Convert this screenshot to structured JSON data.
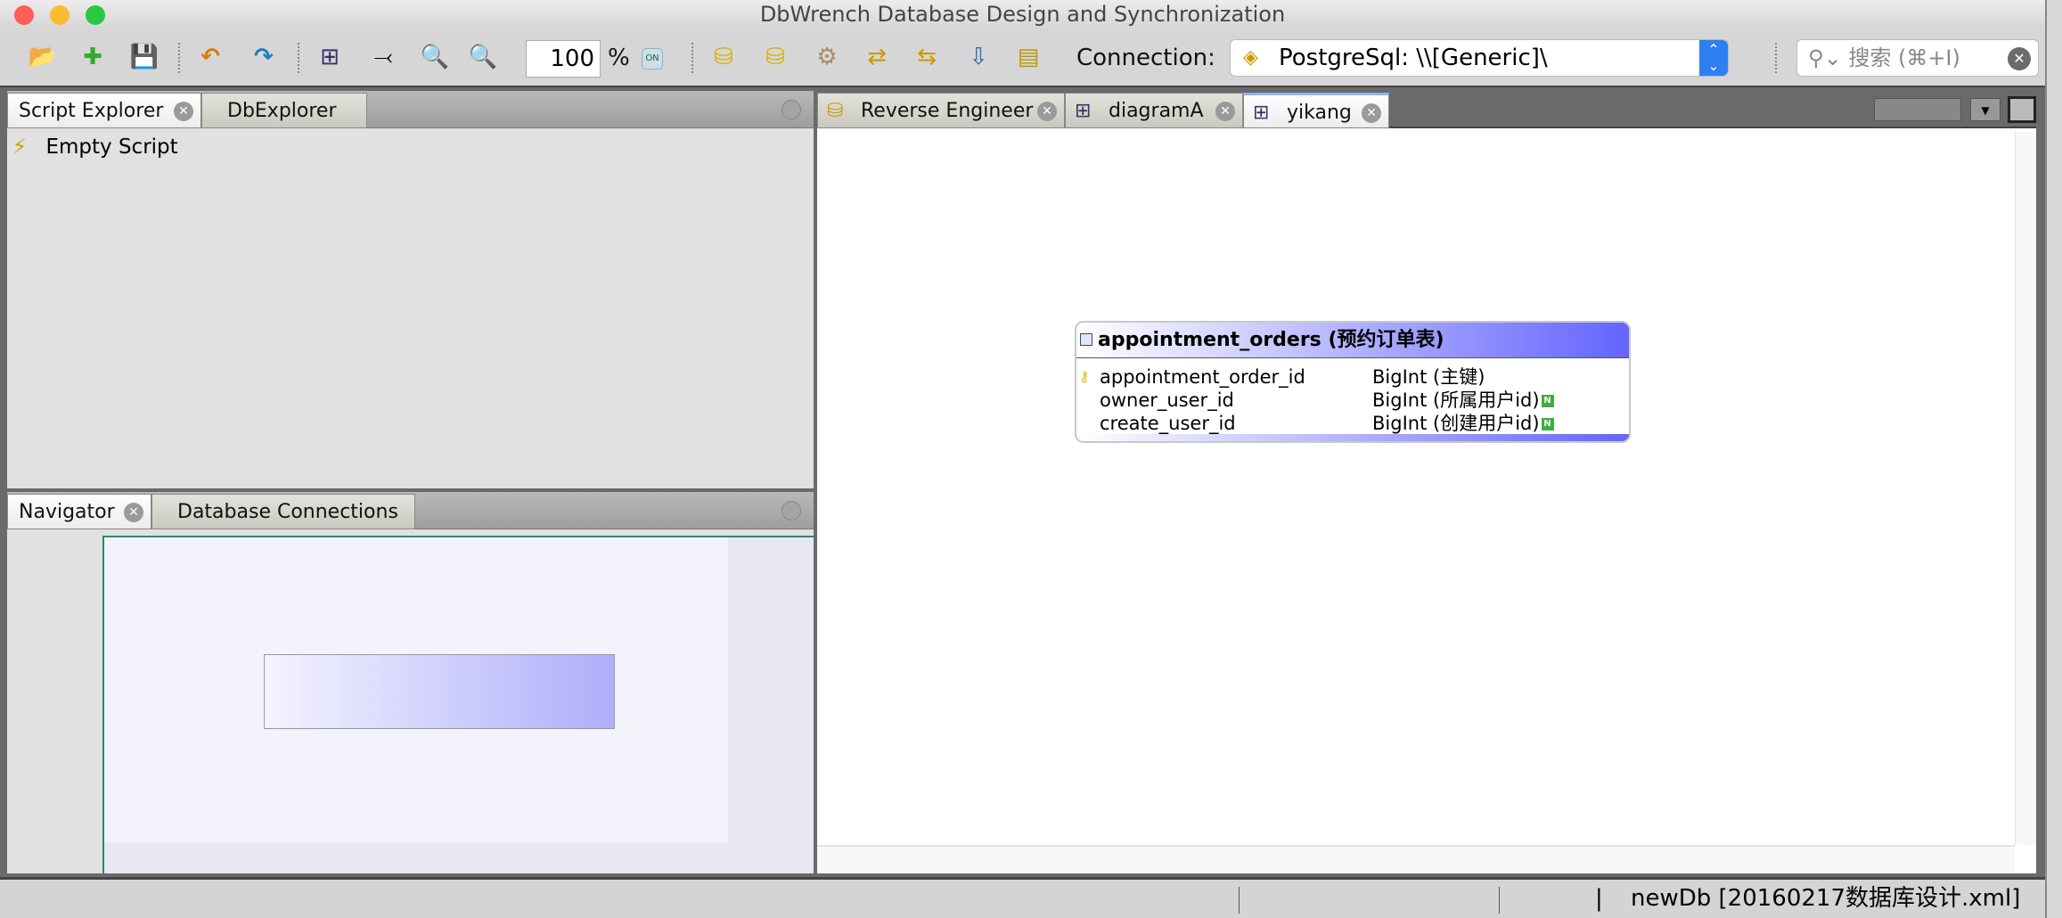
{
  "window": {
    "title": "DbWrench Database Design and Synchronization"
  },
  "toolbar": {
    "icons": [
      "open-icon",
      "new-icon",
      "save-icon",
      "undo-icon",
      "redo-icon",
      "layout-diagram-icon",
      "relationship-icon",
      "zoom-in-icon",
      "zoom-out-icon",
      "zoom-fit-icon",
      "forward-engineer-icon",
      "reverse-engineer-icon",
      "settings-icon",
      "sync-icon",
      "sync-all-icon",
      "export-icon",
      "script-icon"
    ],
    "zoom_value": "100",
    "zoom_unit": "%",
    "fit_label": "ON",
    "connection_label": "Connection:",
    "connection_value": "PostgreSql: \\\\[Generic]\\",
    "search_placeholder": "搜索 (⌘+I)"
  },
  "left_top": {
    "tabs": [
      {
        "label": "Script Explorer",
        "active": true
      },
      {
        "label": "DbExplorer",
        "active": false
      }
    ],
    "items": [
      {
        "label": "Empty Script"
      }
    ]
  },
  "left_bottom": {
    "tabs": [
      {
        "label": "Navigator",
        "active": true
      },
      {
        "label": "Database Connections",
        "active": false
      }
    ]
  },
  "editor": {
    "tabs": [
      {
        "label": "Reverse Engineer",
        "active": false
      },
      {
        "label": "diagramA",
        "active": false
      },
      {
        "label": "yikang",
        "active": true
      }
    ]
  },
  "diagram": {
    "table": {
      "name": "appointment_orders",
      "comment": "(预约订单表)",
      "columns": [
        {
          "name": "appointment_order_id",
          "type": "BigInt",
          "comment": "(主键)",
          "pk": true,
          "nullable": false
        },
        {
          "name": "owner_user_id",
          "type": "BigInt",
          "comment": "(所属用户id)",
          "pk": false,
          "nullable": true,
          "badge": "N"
        },
        {
          "name": "create_user_id",
          "type": "BigInt",
          "comment": "(创建用户id)",
          "pk": false,
          "nullable": true,
          "badge": "N"
        }
      ]
    }
  },
  "status": {
    "separator": "|",
    "project": "newDb [20160217数据库设计.xml]"
  },
  "colors": {
    "header_gradient_end": "#6464ff",
    "nullable_badge": "#3cae3c",
    "connection_arrow": "#2d7ff2"
  }
}
